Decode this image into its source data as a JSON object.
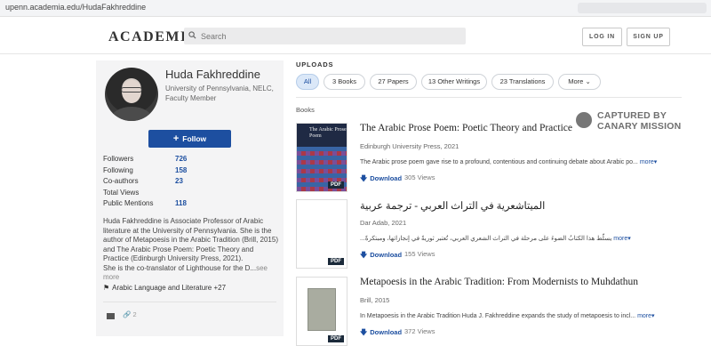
{
  "browser": {
    "url": "upenn.academia.edu/HudaFakhreddine"
  },
  "header": {
    "logo": "ACADEMIA",
    "search_placeholder": "Search",
    "login_label": "LOG IN",
    "signup_label": "SIGN UP"
  },
  "profile": {
    "name": "Huda Fakhreddine",
    "affiliation": "University of Pennsylvania, NELC, Faculty Member",
    "follow_label": "Follow",
    "stats": [
      {
        "label": "Followers",
        "value": "726"
      },
      {
        "label": "Following",
        "value": "158"
      },
      {
        "label": "Co-authors",
        "value": "23"
      },
      {
        "label": "Total Views",
        "value": ""
      },
      {
        "label": "Public Mentions",
        "value": "118"
      }
    ],
    "bio_1": "Huda Fakhreddine is Associate Professor of Arabic literature at the University of Pennsylvania. She is the author of Metapoesis in the Arabic Tradition (Brill, 2015) and The Arabic Prose Poem: Poetic Theory and Practice (Edinburgh University Press, 2021).",
    "bio_2": "She is the co-translator of Lighthouse for the D...",
    "see_more": "see more",
    "tags": "Arabic Language and Literature +27",
    "links_count": "2"
  },
  "uploads": {
    "heading": "UPLOADS",
    "chips": [
      {
        "label": "All",
        "active": true
      },
      {
        "label": "3 Books"
      },
      {
        "label": "27 Papers"
      },
      {
        "label": "13 Other Writings"
      },
      {
        "label": "23 Translations"
      },
      {
        "label": "More"
      }
    ],
    "section_label": "Books",
    "items": [
      {
        "title": "The Arabic Prose Poem: Poetic Theory and Practice",
        "publisher": "Edinburgh University Press, 2021",
        "description": "The Arabic prose poem gave rise to a profound, contentious and continuing debate about Arabic po...",
        "more": "more",
        "download": "Download",
        "views": "305 Views",
        "cover_title": "The Arabic Prose Poem",
        "pdf": "PDF"
      },
      {
        "title": "الميتاشعرية في التراث العربي - ترجمة عربية",
        "publisher": "Dar Adab, 2021",
        "description": "...يسلّط هذا الكتابُ الضوءَ على مرحلة في التراث الشعري العربي، تُعتبر ثوريةً في إنجازاتها، ومبتكرةً",
        "more": "more",
        "download": "Download",
        "views": "155 Views",
        "pdf": "PDF"
      },
      {
        "title": "Metapoesis in the Arabic Tradition: From Modernists to Muhdathun",
        "publisher": "Brill, 2015",
        "description": "In Metapoesis in the Arabic Tradition Huda J. Fakhreddine expands the study of metapoesis to incl...",
        "more": "more",
        "download": "Download",
        "views": "372 Views",
        "pdf": "PDF"
      }
    ]
  },
  "watermark": {
    "line1": "CAPTURED BY",
    "line2": "CANARY MISSION"
  },
  "colors": {
    "brand_blue": "#1d4fa0",
    "chip_active_bg": "#dbe8f8"
  }
}
